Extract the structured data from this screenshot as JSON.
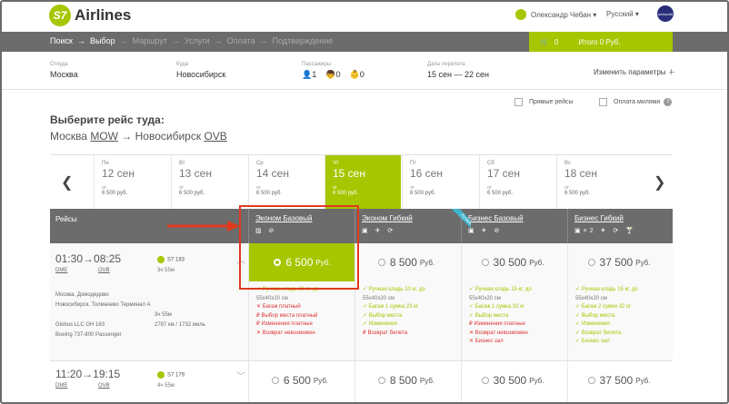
{
  "header": {
    "logo_mark": "S7",
    "logo_text": "Airlines",
    "user": "Олександр Чебан ▾",
    "lang": "Русский ▾",
    "ow": "oneworld"
  },
  "nav": {
    "steps": [
      "Поиск",
      "→",
      "Выбор",
      "→",
      "Маршрут",
      "→",
      "Услуги",
      "→",
      "Оплата",
      "→",
      "Подтверждение"
    ],
    "cart_count": "0",
    "cart_total": "Итого  0 Руб."
  },
  "search": {
    "from_label": "Откуда",
    "from": "Москва",
    "to_label": "Куда",
    "to": "Новосибирск",
    "pax_label": "Пассажиры",
    "adults": "1",
    "children": "0",
    "infants": "0",
    "dates_label": "Даты перелета",
    "dates": "15 сен — 22 сен",
    "change": "Изменить параметры ＋"
  },
  "filters": {
    "direct": "Прямые рейсы",
    "miles": "Оплата милями"
  },
  "title": "Выберите рейс туда:",
  "route": {
    "from": "Москва ",
    "from_code": "MOW",
    "arrow": " → ",
    "to": "Новосибирск ",
    "to_code": "OVB"
  },
  "days": [
    {
      "wd": "Пн",
      "dt": "12 сен",
      "ot": "от",
      "pr": "6 500 руб."
    },
    {
      "wd": "Вт",
      "dt": "13 сен",
      "ot": "от",
      "pr": "6 500 руб."
    },
    {
      "wd": "Ср",
      "dt": "14 сен",
      "ot": "от",
      "pr": "6 500 руб."
    },
    {
      "wd": "Чт",
      "dt": "15 сен",
      "ot": "от",
      "pr": "6 500 руб."
    },
    {
      "wd": "Пт",
      "dt": "16 сен",
      "ot": "от",
      "pr": "6 500 руб."
    },
    {
      "wd": "Сб",
      "dt": "17 сен",
      "ot": "от",
      "pr": "6 500 руб."
    },
    {
      "wd": "Вс",
      "dt": "18 сен",
      "ot": "от",
      "pr": "6 500 руб."
    }
  ],
  "table": {
    "flights": "Рейсы",
    "best": "Лучший!",
    "fares": [
      {
        "t": "Эконом Базовый",
        "ic": "▨ ⊘"
      },
      {
        "t": "Эконом Гибкий",
        "ic": "▣ ✈ ⟳"
      },
      {
        "t": "Бизнес Базовый",
        "ic": "▣ ✈ ⊘"
      },
      {
        "t": "Бизнес Гибкий",
        "ic": "▣×2 ✈ ⟳ 🍸"
      }
    ]
  },
  "flight1": {
    "dep": "01:30",
    "arr": "08:25",
    "arrow": "→",
    "dep_code": "DME",
    "arr_code": "OVB",
    "fl": "S7 183",
    "dur": "3ч 55м",
    "info": "Москва, Домодедово",
    "info_b": "Новосибирск, Толмачево Терминал А",
    "info_c": "Globus LLC GH 183",
    "info_d": "Boeing 737-800 Passenger",
    "dur2": "3ч 55м",
    "dist": "2787 км / 1732 миль",
    "chev": "︿",
    "prices": [
      "6 500",
      "8 500",
      "30 500",
      "37 500"
    ],
    "cur": "Руб.",
    "f1": [
      "✓ Ручная кладь 10 кг, до",
      "   55x40x20 см",
      "✕ Багаж платный",
      "₽ Выбор места платный",
      "₽ Изменения платные",
      "✕ Возврат невозможен"
    ],
    "f2": [
      "✓ Ручная кладь 10 кг, до",
      "   55x40x20 см",
      "✓ Багаж 1 сумка 23 кг",
      "✓ Выбор места",
      "✓ Изменения",
      "₽ Возврат билета"
    ],
    "f3": [
      "✓ Ручная кладь 15 кг, до",
      "   55x40x20 см",
      "✓ Багаж 1 сумка 32 кг",
      "✓ Выбор места",
      "₽ Изменения платные",
      "✕ Возврат невозможен",
      "✕ Бизнес зал"
    ],
    "f4": [
      "✓ Ручная кладь 15 кг, до",
      "   55x40x20 см",
      "✓ Багаж 2 сумки 32 кг",
      "✓ Выбор места",
      "✓ Изменения",
      "✓ Возврат билета",
      "✓ Бизнес зал"
    ]
  },
  "flight2": {
    "dep": "11:20",
    "arr": "19:15",
    "arrow": "→",
    "dep_code": "DME",
    "arr_code": "OVB",
    "fl": "S7 179",
    "dur": "4ч 55м",
    "chev": "﹀",
    "prices": [
      "6 500",
      "8 500",
      "30 500",
      "37 500"
    ],
    "cur": "Руб."
  }
}
